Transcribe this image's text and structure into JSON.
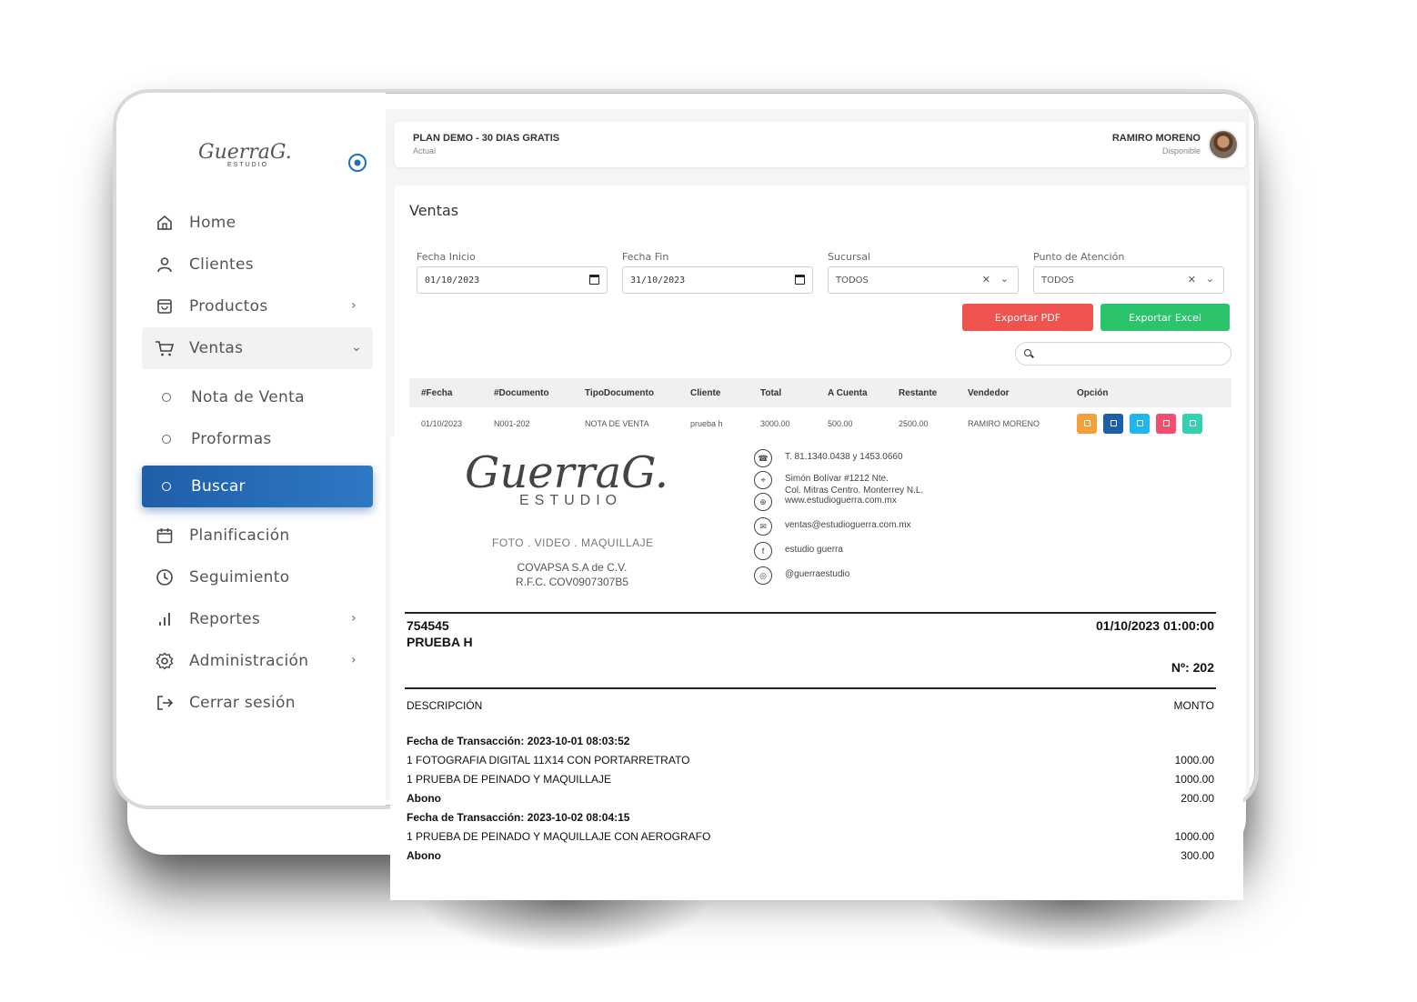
{
  "sidebar": {
    "brand": "GuerraG.",
    "brand_sub": "ESTUDIO",
    "items": [
      {
        "label": "Home",
        "icon": "home-icon"
      },
      {
        "label": "Clientes",
        "icon": "user-icon"
      },
      {
        "label": "Productos",
        "icon": "bag-icon"
      },
      {
        "label": "Ventas",
        "icon": "cart-icon"
      }
    ],
    "subitems": [
      {
        "label": "Nota de Venta"
      },
      {
        "label": "Proformas"
      },
      {
        "label": "Buscar"
      }
    ],
    "items_bottom": [
      {
        "label": "Planificación",
        "icon": "calendar-icon"
      },
      {
        "label": "Seguimiento",
        "icon": "clock-icon"
      },
      {
        "label": "Reportes",
        "icon": "bar-chart-icon"
      },
      {
        "label": "Administración",
        "icon": "gear-icon"
      },
      {
        "label": "Cerrar sesión",
        "icon": "logout-icon"
      }
    ]
  },
  "header": {
    "plan": "PLAN DEMO - 30 DIAS GRATIS",
    "plan_sub": "Actual",
    "user": "RAMIRO MORENO",
    "user_status": "Disponible"
  },
  "page": {
    "title": "Ventas",
    "filters": {
      "start_label": "Fecha Inicio",
      "start_value": "01/10/2023",
      "end_label": "Fecha Fin",
      "end_value": "31/10/2023",
      "branch_label": "Sucursal",
      "branch_value": "TODOS",
      "point_label": "Punto de Atención",
      "point_value": "TODOS"
    },
    "export_pdf": "Exportar PDF",
    "export_excel": "Exportar Excel",
    "table": {
      "headers": [
        "#Fecha",
        "#Documento",
        "TipoDocumento",
        "Cliente",
        "Total",
        "A Cuenta",
        "Restante",
        "Vendedor",
        "Opción"
      ],
      "rows": [
        [
          "01/10/2023",
          "N001-202",
          "NOTA DE VENTA",
          "prueba h",
          "3000.00",
          "500.00",
          "2500.00",
          "RAMIRO MORENO"
        ]
      ],
      "action_colors": [
        "#f5a03a",
        "#1f5fa8",
        "#1fb6f0",
        "#f0506e",
        "#34d1b0"
      ]
    }
  },
  "receipt": {
    "logo": "GuerraG.",
    "logo_sub": "ESTUDIO",
    "tagline": "FOTO . VIDEO . MAQUILLAJE",
    "company": "COVAPSA S.A de C.V.",
    "rfc": "R.F.C.  COV0907307B5",
    "contacts": [
      {
        "icon": "phone-icon",
        "text": "T. 81.1340.0438 y 1453.0660"
      },
      {
        "icon": "location-icon",
        "text": "Simón Bolívar #1212 Nte.",
        "text2": "Col. Mitras Centro. Monterrey N.L."
      },
      {
        "icon": "globe-icon",
        "text": "www.estudioguerra.com.mx"
      },
      {
        "icon": "mail-icon",
        "text": "ventas@estudioguerra.com.mx"
      },
      {
        "icon": "facebook-icon",
        "text": "estudio guerra"
      },
      {
        "icon": "instagram-icon",
        "text": "@guerraestudio"
      }
    ],
    "number": "754545",
    "client": "PRUEBA H",
    "datetime": "01/10/2023 01:00:00",
    "doc_no": "Nº: 202",
    "col_desc": "DESCRIPCIÓN",
    "col_amount": "MONTO",
    "lines": [
      {
        "desc": "Fecha de Transacción: 2023-10-01 08:03:52",
        "amount": "",
        "bold": true
      },
      {
        "desc": "1 FOTOGRAFIA DIGITAL 11X14 CON PORTARRETRATO",
        "amount": "1000.00",
        "bold": false
      },
      {
        "desc": "1 PRUEBA DE PEINADO Y MAQUILLAJE",
        "amount": "1000.00",
        "bold": false
      },
      {
        "desc": "Abono",
        "amount": "200.00",
        "bold": true
      },
      {
        "desc": "Fecha de Transacción: 2023-10-02 08:04:15",
        "amount": "",
        "bold": true
      },
      {
        "desc": "1 PRUEBA DE PEINADO Y MAQUILLAJE CON AEROGRAFO",
        "amount": "1000.00",
        "bold": false
      },
      {
        "desc": "Abono",
        "amount": "300.00",
        "bold": true
      }
    ]
  }
}
